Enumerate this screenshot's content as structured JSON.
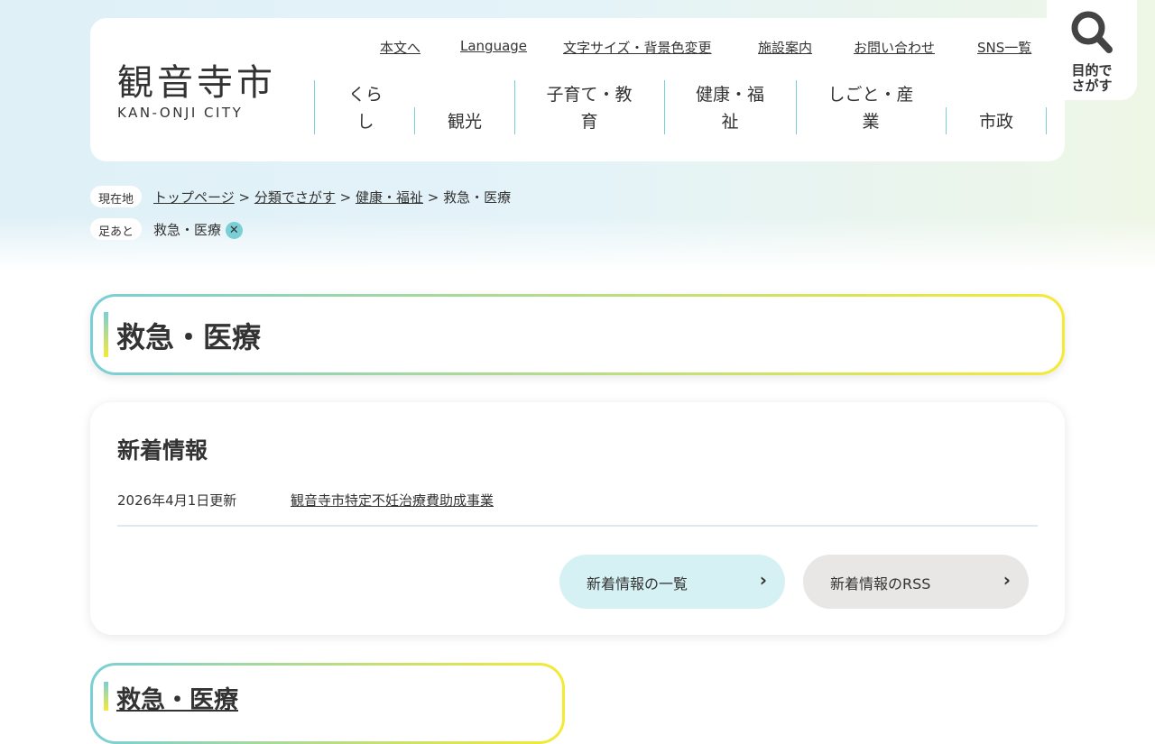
{
  "logo": {
    "jp": "観音寺市",
    "en": "KAN-ONJI CITY"
  },
  "util_links": [
    "本文へ",
    "Language",
    "文字サイズ・背景色変更",
    "施設案内",
    "お問い合わせ",
    "SNS一覧"
  ],
  "nav": [
    {
      "l1": "くら",
      "l2": "し"
    },
    {
      "l1": "観光"
    },
    {
      "l1": "子育て・教",
      "l2": "育"
    },
    {
      "l1": "健康・福",
      "l2": "祉"
    },
    {
      "l1": "しごと・産",
      "l2": "業"
    },
    {
      "l1": "市政"
    }
  ],
  "search": {
    "icon": "search-icon",
    "l1": "目的で",
    "l2": "さがす"
  },
  "breadcrumb": {
    "label": "現在地",
    "items": [
      "トップページ",
      "分類でさがす",
      "健康・福祉"
    ],
    "sep": ">",
    "current": "救急・医療"
  },
  "footprint": {
    "label": "足あと",
    "item": "救急・医療",
    "close": "✕"
  },
  "page_title": "救急・医療",
  "news": {
    "title": "新着情報",
    "date": "2026年4月1日更新",
    "link": "観音寺市特定不妊治療費助成事業",
    "list_button": "新着情報の一覧",
    "rss_button": "新着情報のRSS",
    "chev": "›"
  },
  "section": {
    "title": "救急・医療"
  },
  "colors": {
    "accent": "#7acfd6",
    "accent2": "#f5ea35",
    "list_btn": "#d6f1f4",
    "rss_btn": "#e9e6e6"
  }
}
